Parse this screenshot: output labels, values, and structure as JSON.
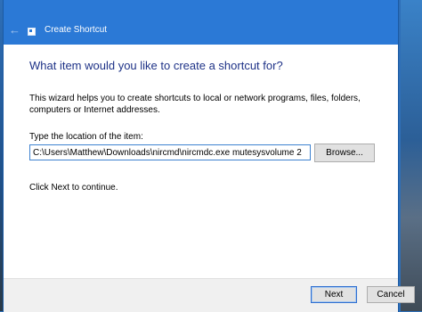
{
  "titlebar": {
    "title": "Create Shortcut",
    "back_icon": "back-arrow-icon"
  },
  "main": {
    "heading": "What item would you like to create a shortcut for?",
    "description": "This wizard helps you to create shortcuts to local or network programs, files, folders, computers or Internet addresses.",
    "location_label": "Type the location of the item:",
    "location_value": "C:\\Users\\Matthew\\Downloads\\nircmd\\nircmdc.exe mutesysvolume 2",
    "browse_label": "Browse...",
    "hint": "Click Next to continue."
  },
  "footer": {
    "next_label": "Next",
    "cancel_label": "Cancel"
  },
  "colors": {
    "titlebar": "#2b79d6",
    "heading": "#1e3287",
    "focus_border": "#3e82d0"
  }
}
